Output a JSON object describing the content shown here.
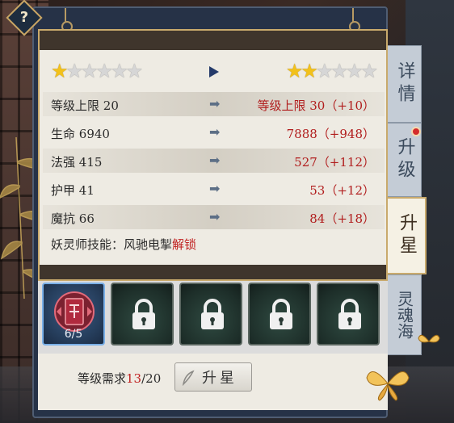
{
  "help": {
    "label": "?"
  },
  "stars": {
    "current": {
      "filled": 1,
      "total": 6
    },
    "next": {
      "filled": 2,
      "total": 6
    }
  },
  "stats": [
    {
      "label": "等级上限",
      "value": "20",
      "arrow": "➡",
      "result": "等级上限 30（+10）"
    },
    {
      "label": "生命",
      "value": "6940",
      "arrow": "➡",
      "result": "7888（+948）"
    },
    {
      "label": "法强",
      "value": "415",
      "arrow": "➡",
      "result": "527（+112）"
    },
    {
      "label": "护甲",
      "value": "41",
      "arrow": "➡",
      "result": "53（+12）"
    },
    {
      "label": "魔抗",
      "value": "66",
      "arrow": "➡",
      "result": "84（+18）"
    }
  ],
  "skill": {
    "prefix": "妖灵师技能：风驰电掣",
    "unlock": "解锁"
  },
  "tabs": [
    {
      "label": "详情",
      "active": false
    },
    {
      "label": "升级",
      "active": false,
      "notify": true
    },
    {
      "label": "升星",
      "active": true
    },
    {
      "label": "灵魂海",
      "active": false
    }
  ],
  "slots": [
    {
      "state": "active",
      "count": "6/5"
    },
    {
      "state": "locked"
    },
    {
      "state": "locked"
    },
    {
      "state": "locked"
    },
    {
      "state": "locked"
    }
  ],
  "requirement": {
    "label": "等级需求",
    "current": "13",
    "sep": "/",
    "max": "20"
  },
  "action": {
    "label": "升星"
  },
  "colors": {
    "accent_red": "#b11d1d",
    "gold": "#c9aa6c",
    "frame_navy": "#263247"
  }
}
